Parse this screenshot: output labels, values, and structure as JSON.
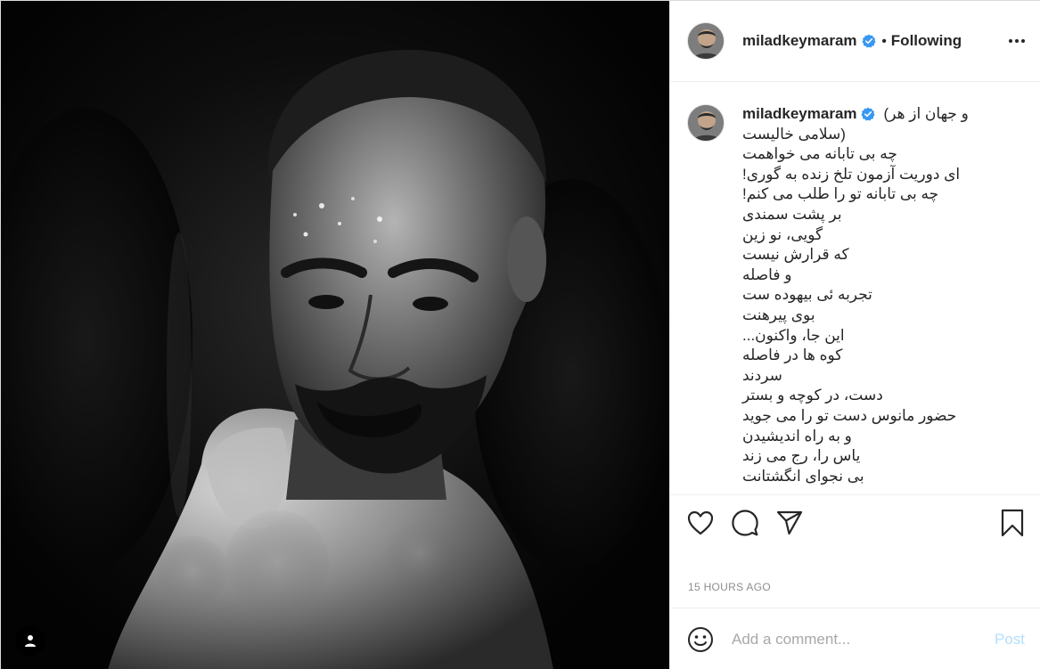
{
  "post": {
    "username": "miladkeymaram",
    "follow_status": "Following",
    "dot_separator": "•",
    "caption_lines": [
      "و جهان از هر)",
      "(سلامی خالیست",
      "چه بی تابانه می خواهمت",
      "ای دوریت آزمون تلخ زنده به گوری!",
      "چه بی تابانه تو را طلب می کنم!",
      "بر پشت سمندی",
      "گویی، نو زین",
      "که قرارش نیست",
      "و فاصله",
      "تجربه ئی بیهوده ست",
      "بوی پیرهنت",
      "این جا، واکنون...",
      "کوه ها در فاصله",
      "سردند",
      "دست، در کوچه و بستر",
      "حضور مانوس دست تو را می جوید",
      "و به راه اندیشیدن",
      "یاس را، رج می زند",
      "بی نجوای انگشتانت"
    ],
    "timestamp": "15 HOURS AGO",
    "comment_placeholder": "Add a comment...",
    "post_button": "Post"
  },
  "icons": {
    "more": "more-options-icon",
    "verified": "verified-badge-icon",
    "like": "heart-icon",
    "comment": "comment-icon",
    "share": "paper-plane-icon",
    "save": "bookmark-icon",
    "emoji": "emoji-icon",
    "tagged_people": "user-tag-icon"
  },
  "colors": {
    "verified_blue": "#3897f0",
    "post_button_disabled": "#b2dffc",
    "muted_text": "#8e8e8e",
    "border": "#efefef"
  }
}
